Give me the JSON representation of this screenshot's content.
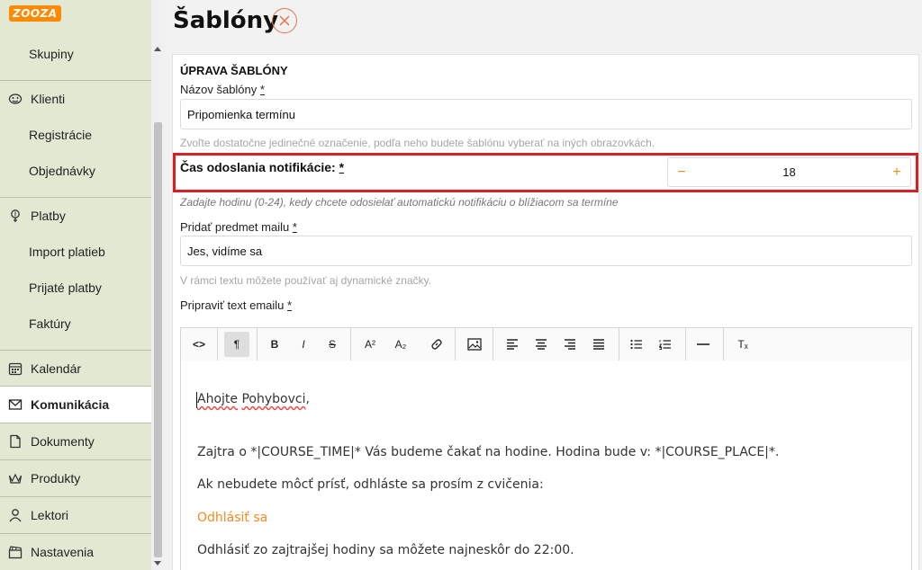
{
  "app": {
    "logo_text": "ZOOZA",
    "brand_color": "#ff8a00",
    "accent_color": "#f08a24",
    "highlight_color": "#d71f26"
  },
  "sidebar": {
    "items": [
      {
        "label": "Skupiny",
        "type": "sub"
      },
      {
        "label": "Klienti",
        "type": "top",
        "icon": "smile-mask-icon"
      },
      {
        "label": "Registrácie",
        "type": "sub"
      },
      {
        "label": "Objednávky",
        "type": "sub"
      },
      {
        "label": "Platby",
        "type": "top",
        "icon": "money-bag-icon"
      },
      {
        "label": "Import platieb",
        "type": "sub"
      },
      {
        "label": "Prijaté platby",
        "type": "sub"
      },
      {
        "label": "Faktúry",
        "type": "sub"
      },
      {
        "label": "Kalendár",
        "type": "top",
        "icon": "calendar-icon"
      },
      {
        "label": "Komunikácia",
        "type": "top",
        "icon": "envelope-icon",
        "active": true
      },
      {
        "label": "Dokumenty",
        "type": "top",
        "icon": "document-icon"
      },
      {
        "label": "Produkty",
        "type": "top",
        "icon": "crown-icon"
      },
      {
        "label": "Lektori",
        "type": "top",
        "icon": "user-icon"
      },
      {
        "label": "Nastavenia",
        "type": "top",
        "icon": "clapperboard-icon"
      }
    ]
  },
  "page": {
    "title": "Šablóny",
    "close_icon": "close-circle-icon"
  },
  "form": {
    "section_title": "ÚPRAVA ŠABLÓNY",
    "name_label": "Názov šablóny",
    "required_mark": "*",
    "name_value": "Pripomienka termínu",
    "name_hint": "Zvoľte dostatočne jedinečné označenie, podľa neho budete šablónu vyberať na iných obrazovkách.",
    "time_label": "Čas odoslania notifikácie:",
    "time_value": "18",
    "time_minus": "−",
    "time_plus": "+",
    "time_hint": "Zadajte hodinu (0-24), kedy chcete odosielať automatickú notifikáciu o blížiacom sa termíne",
    "subject_label": "Pridať predmet mailu",
    "subject_value": "Jes, vidíme sa",
    "subject_hint": "V rámci textu môžete používať aj dynamické značky.",
    "body_label": "Pripraviť text emailu"
  },
  "toolbar": {
    "buttons": [
      {
        "name": "code-view-icon",
        "glyph": "<>"
      },
      {
        "name": "paragraph-format-icon",
        "glyph": "¶"
      },
      {
        "name": "bold-icon",
        "glyph": "B"
      },
      {
        "name": "italic-icon",
        "glyph": "I"
      },
      {
        "name": "strikethrough-icon",
        "glyph": "S"
      },
      {
        "name": "superscript-icon",
        "glyph": "A²"
      },
      {
        "name": "subscript-icon",
        "glyph": "A₂"
      },
      {
        "name": "link-icon",
        "glyph": "🔗"
      },
      {
        "name": "image-icon",
        "glyph": "▣"
      },
      {
        "name": "align-left-icon",
        "glyph": "≡"
      },
      {
        "name": "align-center-icon",
        "glyph": "≡"
      },
      {
        "name": "align-right-icon",
        "glyph": "≡"
      },
      {
        "name": "align-justify-icon",
        "glyph": "≡"
      },
      {
        "name": "bullet-list-icon",
        "glyph": "☰"
      },
      {
        "name": "numbered-list-icon",
        "glyph": "☰"
      },
      {
        "name": "horizontal-rule-icon",
        "glyph": "—"
      },
      {
        "name": "clear-format-icon",
        "glyph": "Tₓ"
      }
    ]
  },
  "editor": {
    "greeting_word1": "Ahojte",
    "greeting_word2": "Pohybovci",
    "greeting_punct": ",",
    "line2": "Zajtra o *|COURSE_TIME|* Vás budeme čakať na hodine. Hodina bude v: *|COURSE_PLACE|*.",
    "line3": "Ak nebudete môcť prísť, odhláste sa prosím z cvičenia:",
    "link_text": "Odhlásiť sa",
    "line5": "Odhlásiť zo zajtrajšej hodiny sa môžete najneskôr do 22:00."
  }
}
